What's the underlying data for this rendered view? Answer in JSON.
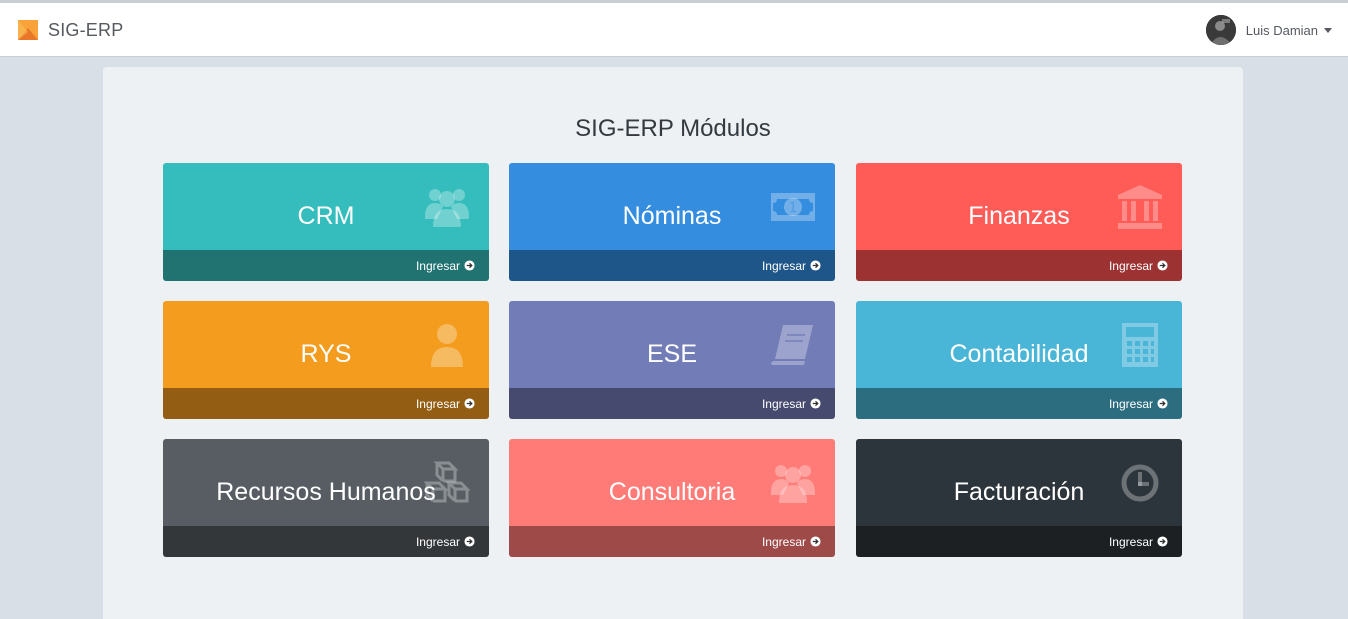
{
  "app": {
    "brand": "SIG-ERP"
  },
  "user": {
    "name": "Luis Damian"
  },
  "page": {
    "title": "SIG-ERP Módulos"
  },
  "modules": [
    {
      "id": "crm",
      "title": "CRM",
      "link": "Ingresar",
      "icon": "users-icon",
      "color": "#34bdbc",
      "footer": "#217371"
    },
    {
      "id": "nominas",
      "title": "Nóminas",
      "link": "Ingresar",
      "icon": "money-icon",
      "color": "#358de0",
      "footer": "#1f5689"
    },
    {
      "id": "finanzas",
      "title": "Finanzas",
      "link": "Ingresar",
      "icon": "bank-icon",
      "color": "#ff5b57",
      "footer": "#9c3231"
    },
    {
      "id": "rys",
      "title": "RYS",
      "link": "Ingresar",
      "icon": "user-icon",
      "color": "#f39c1e",
      "footer": "#935e14"
    },
    {
      "id": "ese",
      "title": "ESE",
      "link": "Ingresar",
      "icon": "book-icon",
      "color": "#727cb6",
      "footer": "#454a6e"
    },
    {
      "id": "contabilidad",
      "title": "Contabilidad",
      "link": "Ingresar",
      "icon": "calculator-icon",
      "color": "#49b5d7",
      "footer": "#2d6d80"
    },
    {
      "id": "recursos-humanos",
      "title": "Recursos Humanos",
      "link": "Ingresar",
      "icon": "cubes-icon",
      "color": "#575d63",
      "footer": "#34373a"
    },
    {
      "id": "consultoria",
      "title": "Consultoria",
      "link": "Ingresar",
      "icon": "users-icon",
      "color": "#ff7b77",
      "footer": "#9e4a48"
    },
    {
      "id": "facturacion",
      "title": "Facturación",
      "link": "Ingresar",
      "icon": "clock-icon",
      "color": "#2d353c",
      "footer": "#1c2023"
    }
  ]
}
